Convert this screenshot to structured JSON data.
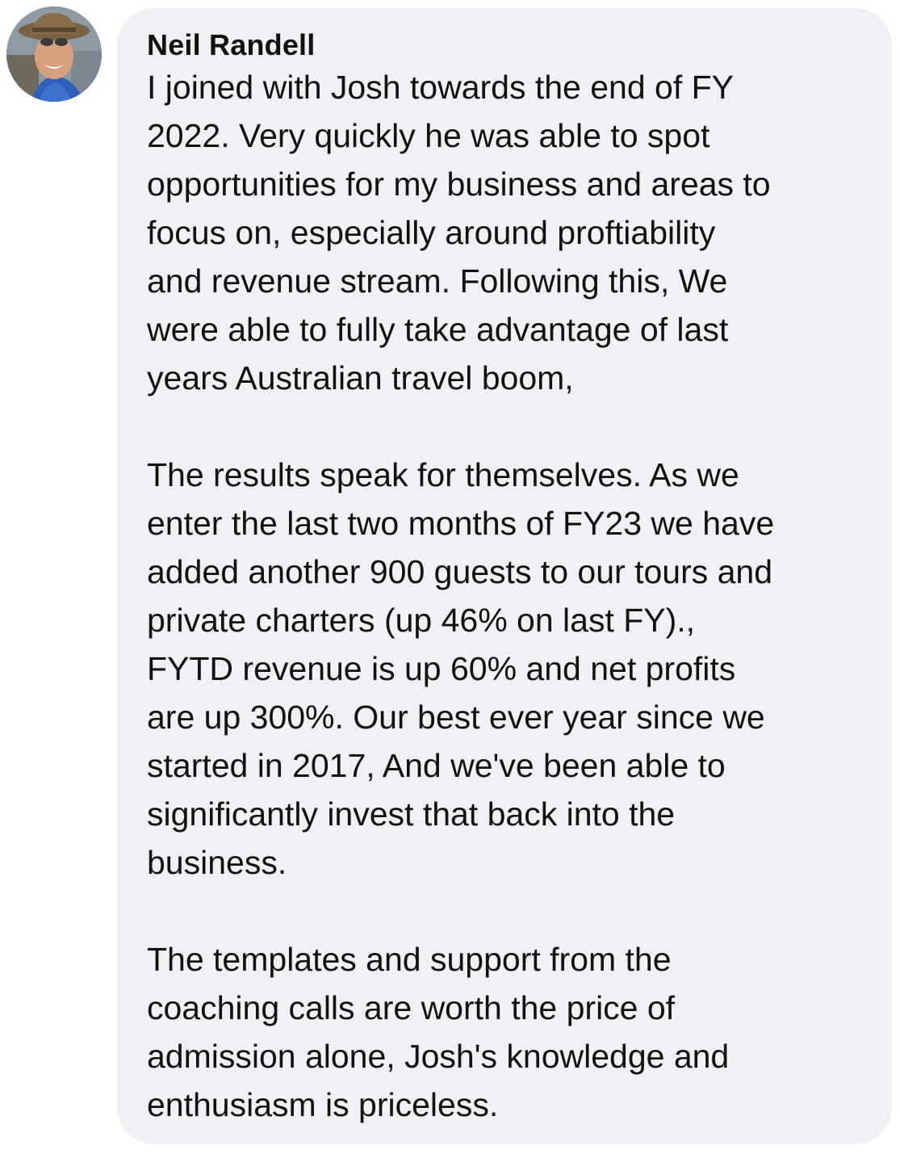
{
  "comment": {
    "author": "Neil Randell",
    "avatar_icon": "profile-photo-man-with-hat",
    "paragraphs": [
      {
        "lines": [
          "I joined with Josh  towards the end of FY",
          "2022. Very quickly he was able to spot",
          "opportunities for my business and areas to",
          "focus on, especially around proftiability",
          "and revenue stream. Following this, We",
          "were able to fully take advantage of last",
          "years Australian travel boom,"
        ]
      },
      {
        "lines": [
          "The results speak for themselves.  As we",
          "enter the last two months of FY23  we have",
          "added another 900 guests to our tours and",
          "private charters (up 46% on last FY).,",
          "FYTD revenue is up 60% and net profits",
          "are up 300%. Our best ever year since we",
          "started in 2017, And we've been able to",
          "significantly invest that back into the",
          "business."
        ]
      },
      {
        "lines": [
          "The templates and support from the",
          "coaching calls are worth the price of",
          "admission alone, Josh's knowledge and",
          "enthusiasm is priceless."
        ]
      }
    ]
  },
  "colors": {
    "bubble_background": "#f0f1f5",
    "text": "#111111"
  }
}
